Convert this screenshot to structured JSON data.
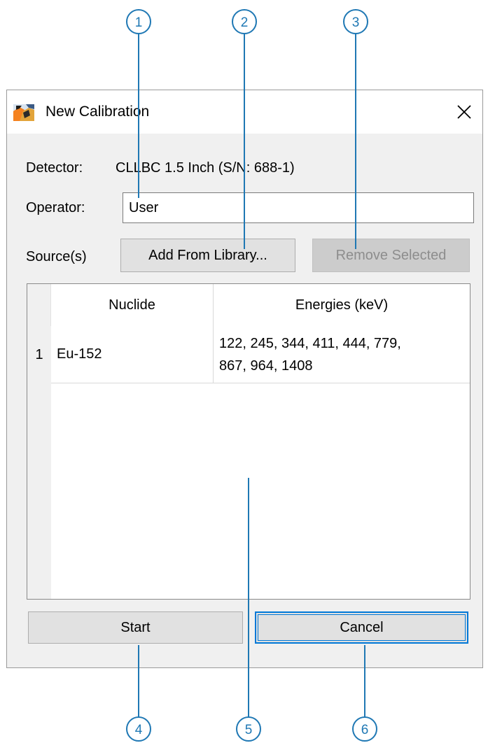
{
  "window": {
    "title": "New Calibration",
    "close_glyph": "✕"
  },
  "icons": {
    "app": "calibration-app-icon",
    "close": "close-icon"
  },
  "colors": {
    "callout": "#1f78b4",
    "default_button_border": "#0078d7",
    "window_bg": "#f0f0f0"
  },
  "detector": {
    "label": "Detector:",
    "value": "CLLBC 1.5 Inch (S/N: 688-1)"
  },
  "operator": {
    "label": "Operator:",
    "value": "User",
    "placeholder": ""
  },
  "sources": {
    "label": "Source(s)",
    "add_button": "Add From Library...",
    "remove_button": "Remove Selected",
    "remove_enabled": false
  },
  "table": {
    "columns": [
      "",
      "Nuclide",
      "Energies (keV)"
    ],
    "rows": [
      {
        "index": "1",
        "nuclide": "Eu-152",
        "energies_line1": "122, 245, 344, 411, 444, 779,",
        "energies_line2": "867, 964, 1408"
      }
    ]
  },
  "footer": {
    "start_button": "Start",
    "cancel_button": "Cancel",
    "default_button": "Cancel"
  },
  "callouts": [
    "1",
    "2",
    "3",
    "4",
    "5",
    "6"
  ]
}
